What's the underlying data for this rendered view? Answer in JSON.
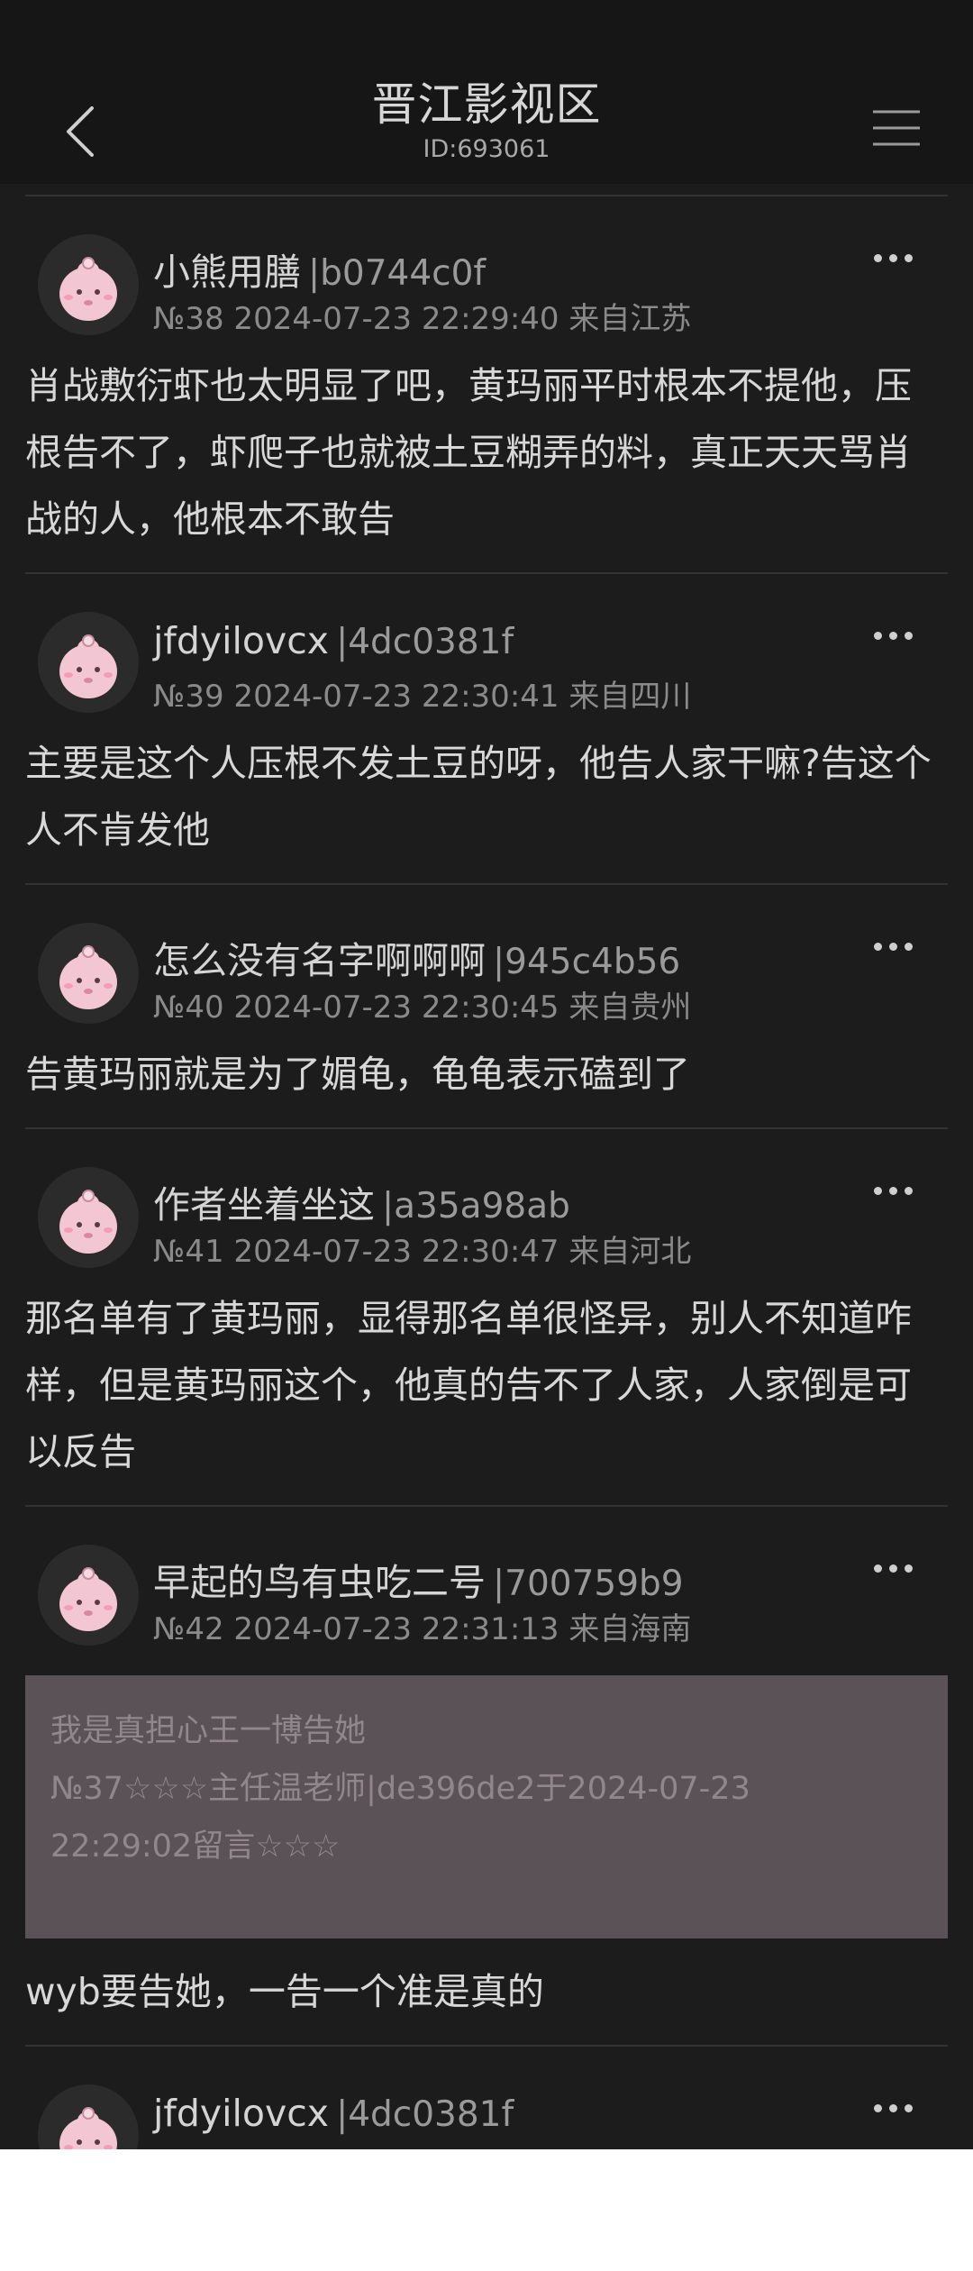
{
  "header": {
    "title": "晋江影视区",
    "id_label": "ID:693061"
  },
  "posts": [
    {
      "name": "小熊用膳",
      "uid": "|b0744c0f",
      "meta": "№38 2024-07-23 22:29:40 来自江苏",
      "content": "肖战敷衍虾也太明显了吧，黄玛丽平时根本不提他，压根告不了，虾爬子也就被土豆糊弄的料，真正天天骂肖战的人，他根本不敢告"
    },
    {
      "name": "jfdyilovcx",
      "uid": "|4dc0381f",
      "meta": "№39 2024-07-23 22:30:41 来自四川",
      "content": "主要是这个人压根不发土豆的呀，他告人家干嘛?告这个人不肯发他"
    },
    {
      "name": "怎么没有名字啊啊啊",
      "uid": "|945c4b56",
      "meta": "№40 2024-07-23 22:30:45 来自贵州",
      "content": "告黄玛丽就是为了媚龟，龟龟表示磕到了"
    },
    {
      "name": "作者坐着坐这",
      "uid": "|a35a98ab",
      "meta": "№41 2024-07-23 22:30:47 来自河北",
      "content": "那名单有了黄玛丽，显得那名单很怪异，别人不知道咋样，但是黄玛丽这个，他真的告不了人家，人家倒是可以反告"
    },
    {
      "name": "早起的鸟有虫吃二号",
      "uid": "|700759b9",
      "meta": "№42 2024-07-23 22:31:13 来自海南",
      "quote": {
        "line1": "我是真担心王一博告她",
        "line2": "№37☆☆☆主任温老师|de396de2于2024-07-23",
        "line3": "22:29:02留言☆☆☆"
      },
      "content": "wyb要告她，一告一个准是真的"
    },
    {
      "name": "jfdyilovcx",
      "uid": "|4dc0381f",
      "meta": "",
      "content": ""
    }
  ],
  "colors": {
    "background": "#1c1c1c",
    "navbar": "#161616",
    "quote_bg": "#5b5257",
    "text": "#d8d8d8",
    "meta": "#8a8a8a"
  },
  "icons": {
    "back": "chevron-left-icon",
    "menu": "hamburger-menu-icon",
    "more": "more-dots-icon",
    "avatar": "pink-creature-avatar"
  }
}
